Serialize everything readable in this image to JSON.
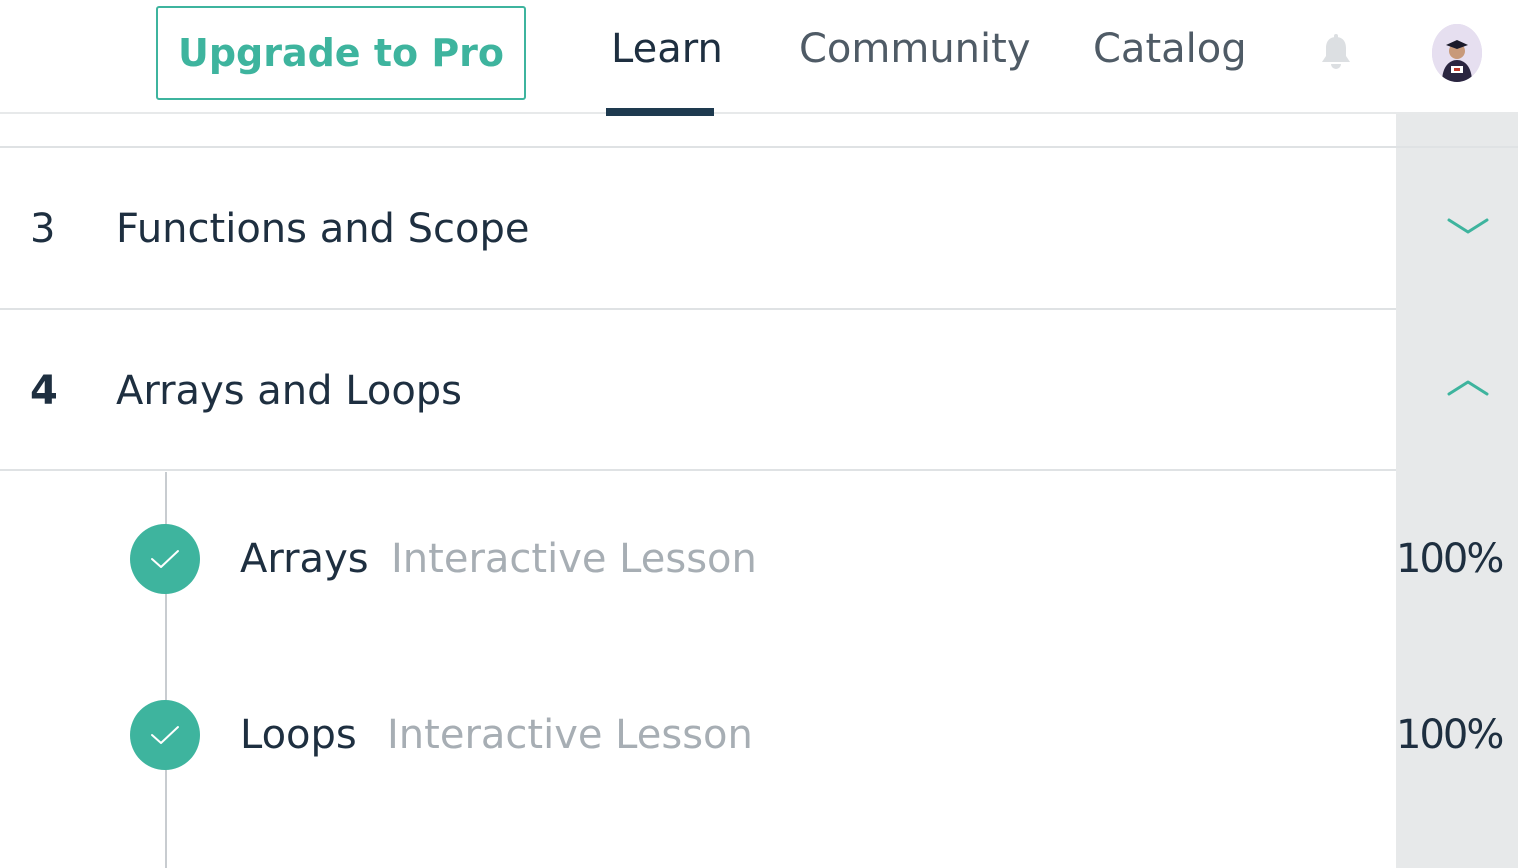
{
  "header": {
    "upgrade_label": "Upgrade to Pro",
    "nav": [
      {
        "label": "Learn",
        "active": true
      },
      {
        "label": "Community",
        "active": false
      },
      {
        "label": "Catalog",
        "active": false
      }
    ],
    "icons": {
      "notifications": "bell-icon",
      "profile": "avatar"
    }
  },
  "sections": [
    {
      "number": "3",
      "title": "Functions and Scope",
      "expanded": false,
      "chevron": "chevron-down-icon"
    },
    {
      "number": "4",
      "title": "Arrays and Loops",
      "expanded": true,
      "chevron": "chevron-up-icon",
      "lessons": [
        {
          "title": "Arrays",
          "type": "Interactive Lesson",
          "progress": "100%",
          "completed": true
        },
        {
          "title": "Loops",
          "type": "Interactive Lesson",
          "progress": "100%",
          "completed": true
        }
      ]
    }
  ],
  "colors": {
    "accent": "#3eb49e",
    "text_dark": "#1e2f40",
    "text_muted": "#a7aeb4",
    "side_column": "#e7e9ea"
  }
}
